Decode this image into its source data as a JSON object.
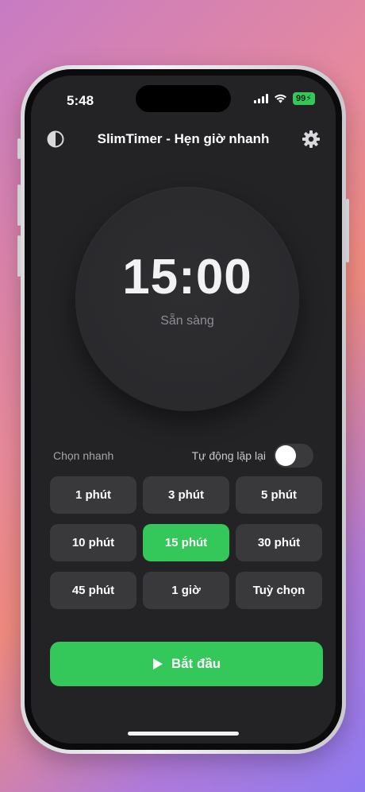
{
  "status_bar": {
    "time": "5:48",
    "battery": "99"
  },
  "header": {
    "title": "SlimTimer - Hẹn giờ nhanh",
    "left_icon": "theme-contrast-icon",
    "right_icon": "gear-icon"
  },
  "timer": {
    "display": "15:00",
    "state": "Sẵn sàng"
  },
  "quick": {
    "label": "Chọn nhanh",
    "auto_repeat_label": "Tự động lặp lại",
    "auto_repeat_on": false
  },
  "presets": [
    {
      "label": "1 phút",
      "selected": false
    },
    {
      "label": "3 phút",
      "selected": false
    },
    {
      "label": "5 phút",
      "selected": false
    },
    {
      "label": "10 phút",
      "selected": false
    },
    {
      "label": "15 phút",
      "selected": true
    },
    {
      "label": "30 phút",
      "selected": false
    },
    {
      "label": "45 phút",
      "selected": false
    },
    {
      "label": "1 giờ",
      "selected": false
    },
    {
      "label": "Tuỳ chọn",
      "selected": false
    }
  ],
  "start_button": {
    "label": "Bắt đầu",
    "icon": "play-icon"
  },
  "colors": {
    "accent": "#34c759",
    "screen_bg": "#232326",
    "button_bg": "#39393c"
  }
}
